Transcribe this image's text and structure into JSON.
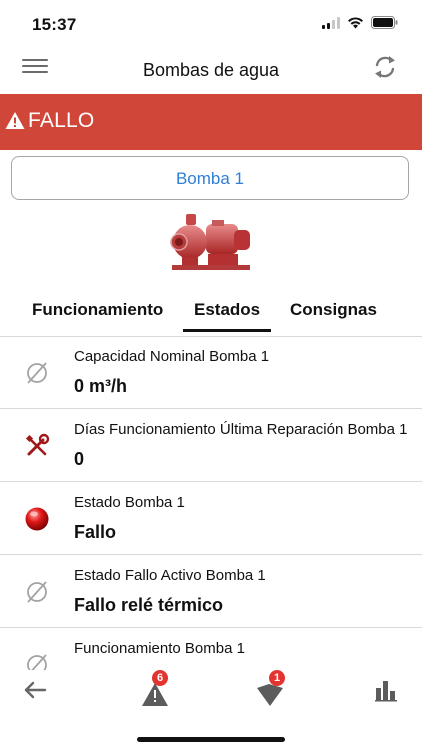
{
  "status_bar": {
    "time": "15:37"
  },
  "nav": {
    "title": "Bombas de agua"
  },
  "alarm": {
    "label": "FALLO",
    "color": "#d0473a"
  },
  "device_select": {
    "value": "Bomba 1",
    "accent": "#2f7fd3"
  },
  "tabs": [
    {
      "label": "Funcionamiento",
      "active": false
    },
    {
      "label": "Estados",
      "active": true
    },
    {
      "label": "Consignas",
      "active": false
    }
  ],
  "rows": [
    {
      "icon": "null-symbol-icon",
      "label": "Capacidad Nominal Bomba 1",
      "value": "0 m³/h"
    },
    {
      "icon": "tools-icon",
      "label": "Días Funcionamiento Última Reparación Bomba 1",
      "value": "0"
    },
    {
      "icon": "red-led-icon",
      "label": "Estado Bomba 1",
      "value": "Fallo"
    },
    {
      "icon": "null-symbol-icon",
      "label": "Estado Fallo Activo Bomba 1",
      "value": "Fallo relé térmico"
    },
    {
      "icon": "null-symbol-icon",
      "label": "Funcionamiento Bomba 1",
      "value": ""
    }
  ],
  "bottom_bar": {
    "alarms_badge": "6",
    "notifications_badge": "1"
  }
}
